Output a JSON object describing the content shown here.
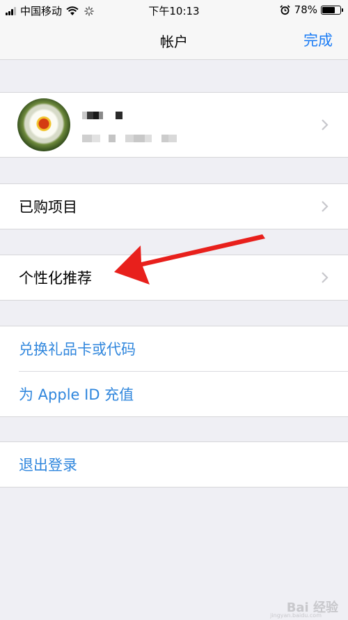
{
  "status_bar": {
    "carrier": "中国移动",
    "time": "下午10:13",
    "battery": "78%",
    "battery_level": 0.78
  },
  "nav": {
    "title": "帐户",
    "done_label": "完成"
  },
  "menu": {
    "purchased": "已购项目",
    "personalized": "个性化推荐",
    "redeem": "兑换礼品卡或代码",
    "add_funds": "为 Apple ID 充值",
    "sign_out": "退出登录"
  },
  "watermark": {
    "brand": "Bai 经验",
    "url": "jingyan.baidu.com"
  },
  "colors": {
    "link": "#2f86dd",
    "done": "#1b7cf5",
    "arrow": "#e8201c",
    "background": "#efeff4"
  },
  "icons": [
    "signal-icon",
    "wifi-icon",
    "loading-icon",
    "alarm-icon",
    "battery-icon",
    "chevron-right-icon"
  ]
}
